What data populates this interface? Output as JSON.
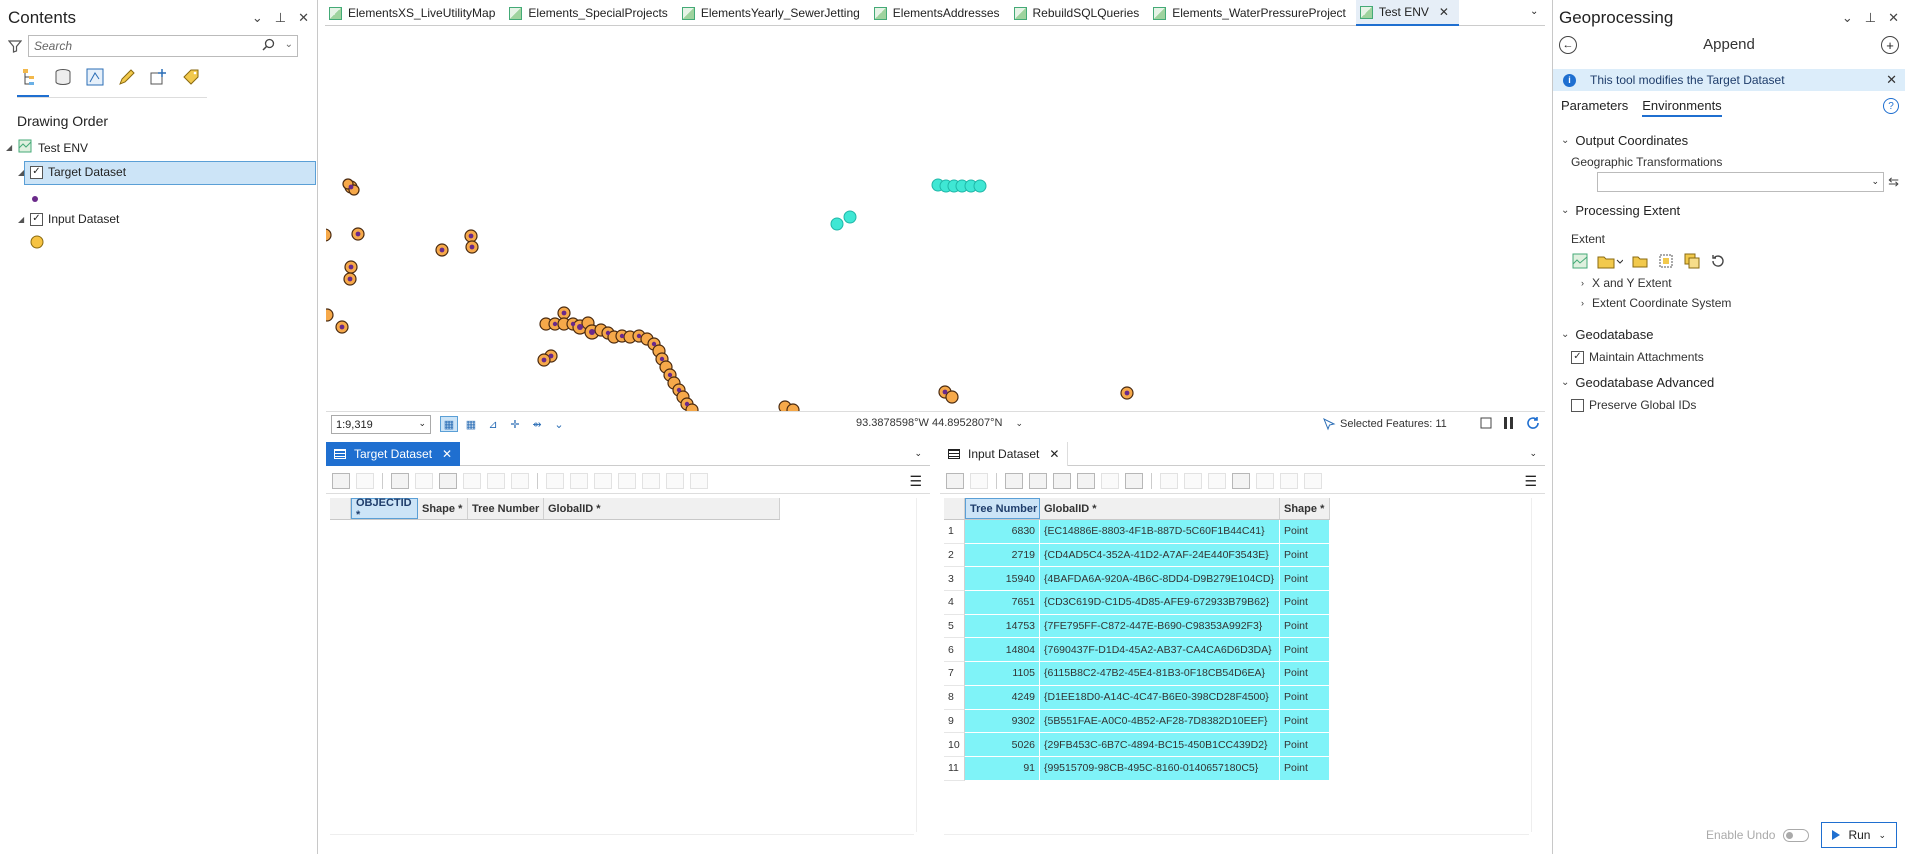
{
  "contents": {
    "title": "Contents",
    "search_placeholder": "Search",
    "drawing_order": "Drawing Order",
    "map_name": "Test ENV",
    "layers": [
      {
        "name": "Target Dataset",
        "checked": true
      },
      {
        "name": "Input Dataset",
        "checked": true
      }
    ]
  },
  "doc_tabs": [
    {
      "label": "ElementsXS_LiveUtilityMap"
    },
    {
      "label": "Elements_SpecialProjects"
    },
    {
      "label": "ElementsYearly_SewerJetting"
    },
    {
      "label": "ElementsAddresses"
    },
    {
      "label": "RebuildSQLQueries"
    },
    {
      "label": "Elements_WaterPressureProject"
    },
    {
      "label": "Test ENV",
      "active": true
    }
  ],
  "map_status": {
    "scale": "1:9,319",
    "coordinates": "93.3878598°W 44.8952807°N",
    "selected_features": "Selected Features: 11"
  },
  "target_table": {
    "tab": "Target Dataset",
    "columns": [
      "OBJECTID *",
      "Shape *",
      "Tree Number",
      "GlobalID *"
    ]
  },
  "input_table": {
    "tab": "Input Dataset",
    "columns": [
      "Tree Number",
      "GlobalID *",
      "Shape *"
    ],
    "rows": [
      {
        "n": "1",
        "tree": "6830",
        "gid": "{EC14886E-8803-4F1B-887D-5C60F1B44C41}",
        "shape": "Point"
      },
      {
        "n": "2",
        "tree": "2719",
        "gid": "{CD4AD5C4-352A-41D2-A7AF-24E440F3543E}",
        "shape": "Point"
      },
      {
        "n": "3",
        "tree": "15940",
        "gid": "{4BAFDA6A-920A-4B6C-8DD4-D9B279E104CD}",
        "shape": "Point"
      },
      {
        "n": "4",
        "tree": "7651",
        "gid": "{CD3C619D-C1D5-4D85-AFE9-672933B79B62}",
        "shape": "Point"
      },
      {
        "n": "5",
        "tree": "14753",
        "gid": "{7FE795FF-C872-447E-B690-C98353A992F3}",
        "shape": "Point"
      },
      {
        "n": "6",
        "tree": "14804",
        "gid": "{7690437F-D1D4-45A2-AB37-CA4CA6D6D3DA}",
        "shape": "Point"
      },
      {
        "n": "7",
        "tree": "1105",
        "gid": "{6115B8C2-47B2-45E4-81B3-0F18CB54D6EA}",
        "shape": "Point"
      },
      {
        "n": "8",
        "tree": "4249",
        "gid": "{D1EE18D0-A14C-4C47-B6E0-398CD28F4500}",
        "shape": "Point"
      },
      {
        "n": "9",
        "tree": "9302",
        "gid": "{5B551FAE-A0C0-4B52-AF28-7D8382D10EEF}",
        "shape": "Point"
      },
      {
        "n": "10",
        "tree": "5026",
        "gid": "{29FB453C-6B7C-4894-BC15-450B1CC439D2}",
        "shape": "Point"
      },
      {
        "n": "11",
        "tree": "91",
        "gid": "{99515709-98CB-495C-8160-0140657180C5}",
        "shape": "Point"
      }
    ]
  },
  "geoprocessing": {
    "title": "Geoprocessing",
    "tool": "Append",
    "info": "This tool modifies the Target Dataset",
    "tabs": [
      "Parameters",
      "Environments"
    ],
    "sections": {
      "output_coordinates": "Output Coordinates",
      "geographic_transformations": "Geographic Transformations",
      "processing_extent": "Processing Extent",
      "extent": "Extent",
      "xy_extent": "X and Y Extent",
      "extent_cs": "Extent Coordinate System",
      "geodatabase": "Geodatabase",
      "maintain_attachments": "Maintain Attachments",
      "geodatabase_advanced": "Geodatabase Advanced",
      "preserve_global_ids": "Preserve Global IDs"
    },
    "enable_undo": "Enable Undo",
    "run": "Run"
  },
  "colors": {
    "accent": "#1f6fd0",
    "selected_row": "#7ff3f8",
    "point_fill": "#f6a94a",
    "point_core": "#6a2a8a",
    "input_point": "#3fe7d4"
  }
}
